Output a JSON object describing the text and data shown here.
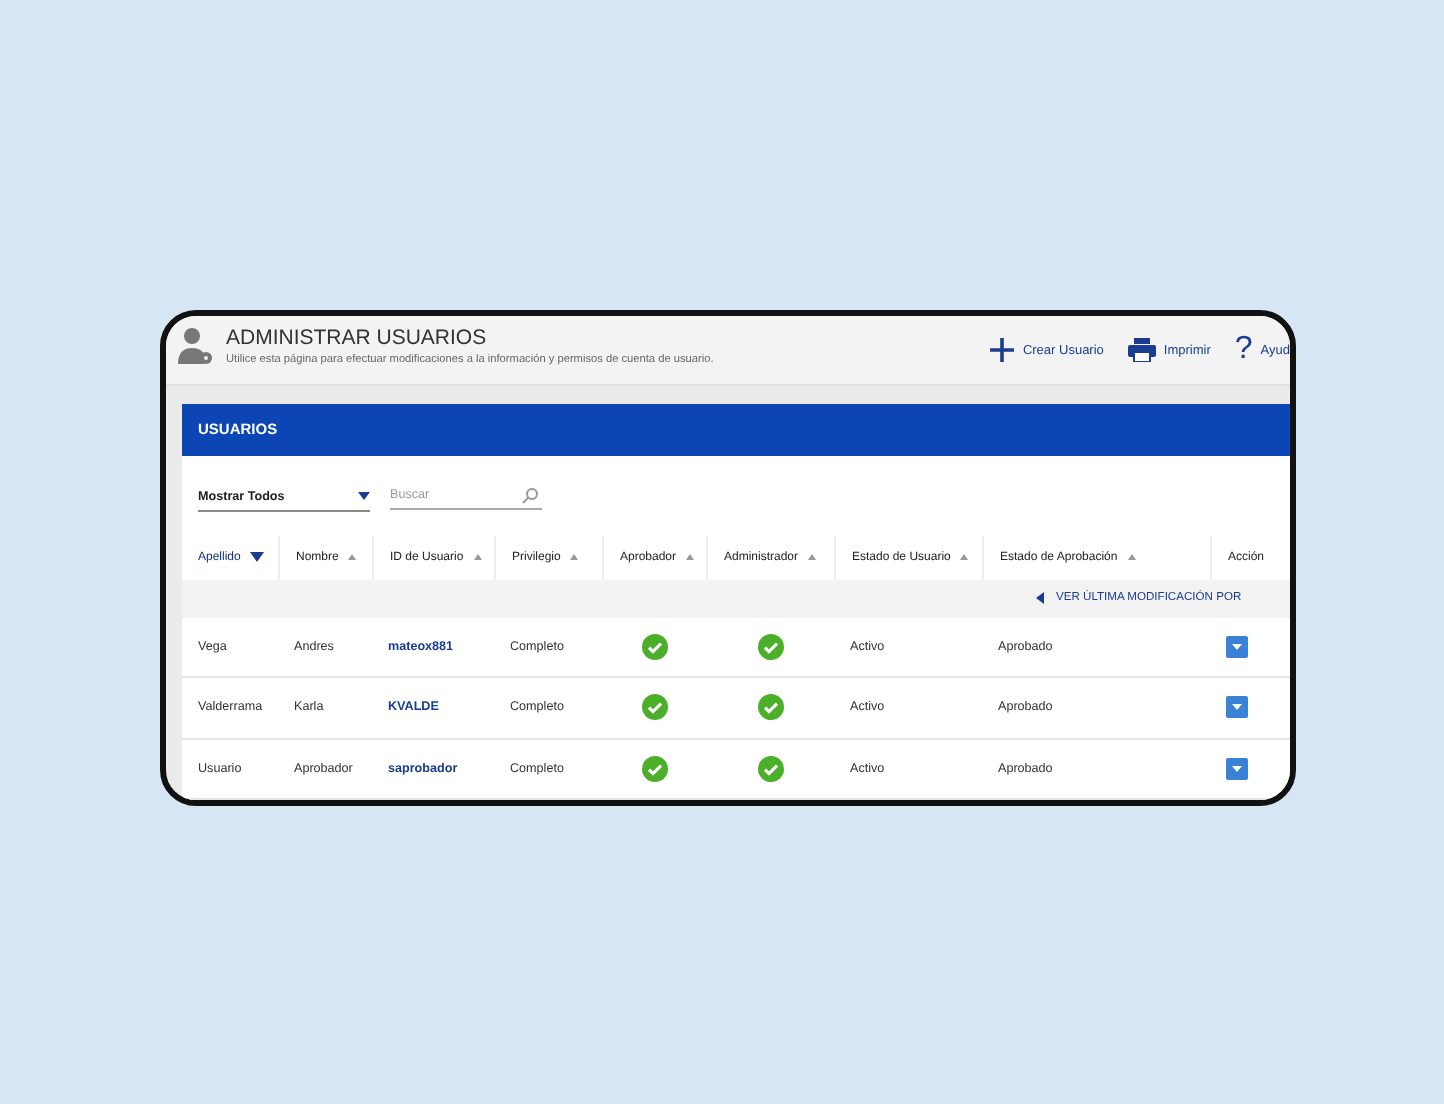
{
  "header": {
    "title": "ADMINISTRAR USUARIOS",
    "subtitle": "Utilice esta página para efectuar modificaciones a la información y permisos de cuenta de usuario.",
    "actions": [
      {
        "kind": "add",
        "label": "Crear Usuario"
      },
      {
        "kind": "print",
        "label": "Imprimir"
      },
      {
        "kind": "help",
        "icon": "?",
        "label": "Ayud"
      }
    ]
  },
  "panel": {
    "title": "USUARIOS",
    "filter": {
      "value": "Mostrar Todos"
    },
    "search": {
      "placeholder": "Buscar"
    }
  },
  "table": {
    "columns": [
      {
        "label": "Apellido",
        "sortable": true,
        "selected": true
      },
      {
        "label": "Nombre",
        "sortable": true,
        "selected": false
      },
      {
        "label": "ID de Usuario",
        "sortable": true,
        "selected": false
      },
      {
        "label": "Privilegio",
        "sortable": true,
        "selected": false
      },
      {
        "label": "Aprobador",
        "sortable": true,
        "selected": false
      },
      {
        "label": "Administrador",
        "sortable": true,
        "selected": false
      },
      {
        "label": "Estado de Usuario",
        "sortable": true,
        "selected": false
      },
      {
        "label": "Estado de Aprobación",
        "sortable": true,
        "selected": false
      },
      {
        "label": "Acción",
        "sortable": false,
        "selected": false
      }
    ],
    "history_link": "VER ÚLTIMA MODIFICACIÓN POR",
    "rows": [
      {
        "apellido": "Vega",
        "nombre": "Andres",
        "id": "mateox881",
        "privilegio": "Completo",
        "aprobador": true,
        "administrador": true,
        "estado_usuario": "Activo",
        "estado_aprobacion": "Aprobado"
      },
      {
        "apellido": "Valderrama",
        "nombre": "Karla",
        "id": "KVALDE",
        "privilegio": "Completo",
        "aprobador": true,
        "administrador": true,
        "estado_usuario": "Activo",
        "estado_aprobacion": "Aprobado"
      },
      {
        "apellido": "Usuario",
        "nombre": "Aprobador",
        "id": "saprobador",
        "privilegio": "Completo",
        "aprobador": true,
        "administrador": true,
        "estado_usuario": "Activo",
        "estado_aprobacion": "Aprobado"
      }
    ]
  }
}
